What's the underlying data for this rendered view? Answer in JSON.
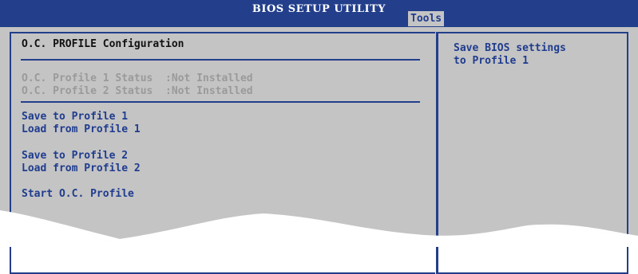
{
  "title": "BIOS SETUP UTILITY",
  "active_tab": "Tools",
  "section_heading": "O.C. PROFILE Configuration",
  "status": [
    {
      "label": "O.C. Profile 1 Status",
      "value": ":Not Installed"
    },
    {
      "label": "O.C. Profile 2 Status",
      "value": ":Not Installed"
    }
  ],
  "menu": {
    "save_profile_1": "Save to Profile 1",
    "load_profile_1": "Load from Profile 1",
    "save_profile_2": "Save to Profile 2",
    "load_profile_2": "Load from Profile 2",
    "start_oc_profile": "Start O.C. Profile"
  },
  "help_text": "Save BIOS settings\nto Profile 1",
  "colors": {
    "title_bar": "#233f8c",
    "panel": "#c4c4c4",
    "menu_text": "#1f3c8e",
    "disabled_text": "#9a9a9a"
  }
}
